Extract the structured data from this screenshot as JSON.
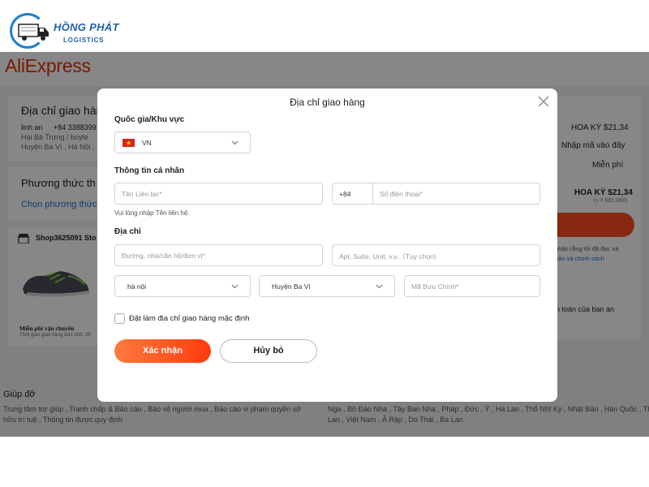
{
  "watermark": {
    "brand_name": "HỒNG PHÁT",
    "brand_sub": "LOGISTICS",
    "icon": "truck-icon",
    "color": "#1f5fa8"
  },
  "background": {
    "app_logo": "AliExpress",
    "address_section": {
      "title": "Địa chỉ giao hàn",
      "name": "linh an",
      "phone": "+84 3388399",
      "line1": "Hai Bà Trưng / boyte",
      "line2": "Huyện Ba Vì , Hà Nội ,"
    },
    "payment_section": {
      "title": "Phương thức th",
      "link": "Chọn phương thức"
    },
    "shop": {
      "name": "Shop3625091 Sto",
      "shipping": "Miễn phí vận chuyển",
      "delivery": "Thời gian giao hàng ước tính: 26"
    },
    "summary": {
      "line1": "HOA KỲ $21,34",
      "coupon": "Nhập mã vào đây",
      "shipping": "Miễn phí",
      "total": "HOA KỲ $21,34",
      "total_vnd": "(≈ ₫ 501.068)",
      "terms1": "nhận rằng tôi đã đọc và",
      "terms2": "oản và chính sách",
      "pay_note": "nh toán của bạn an"
    },
    "footer": {
      "help_title": "Giúp đỡ",
      "help_links1": "Trung tâm trợ giúp , Tranh chấp & Báo cáo , Bảo vệ người mua , Báo cáo vi phạm quyền sở",
      "help_links2": "hữu trí tuệ , Thông tin được quy định",
      "countries1": "Nga , Bồ Đào Nha , Tây Ban Nha , Pháp , Đức , Ý , Hà Lan , Thổ Nhĩ Kỳ , Nhật Bản , Hàn Quốc , Thái",
      "countries2": "Lan , Việt Nam , Ả Rập , Do Thái , Ba Lan"
    }
  },
  "modal": {
    "title": "Địa chỉ giao hàng",
    "country_label": "Quốc gia/Khu vực",
    "country_value": "VN",
    "personal_label": "Thông tin cá nhân",
    "contact_placeholder": "Tên Liên lạc*",
    "phone_code": "+84",
    "phone_placeholder": "Số điện thoại*",
    "contact_helper": "Vui lòng nhập Tên liên hệ.",
    "address_label": "Địa chỉ",
    "street_placeholder": "Đường, nhà/căn hộ/đơn vị*",
    "apt_placeholder": "Apt, Suite, Unit, v.v.（Tùy chọn)",
    "province_value": "hà nội",
    "district_value": "Huyện Ba Vì",
    "postal_placeholder": "Mã Bưu Chính*",
    "default_checkbox_label": "Đặt làm địa chỉ giao hàng mặc định",
    "confirm_label": "Xác nhận",
    "cancel_label": "Hủy bỏ",
    "accent_color": "#ff4f1f"
  }
}
